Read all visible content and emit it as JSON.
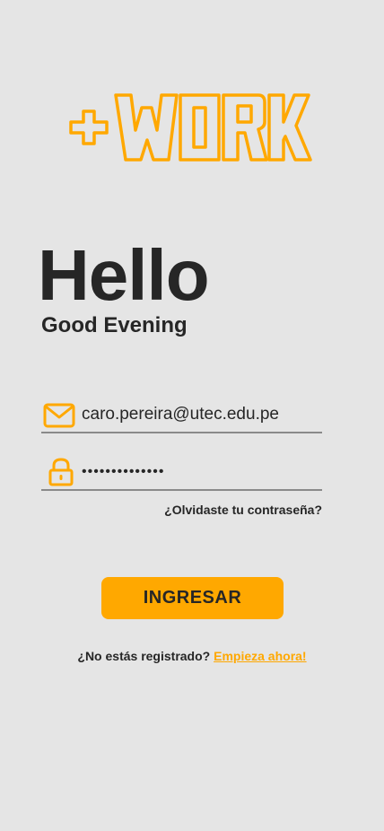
{
  "brand": {
    "logo_text": "+WORK",
    "accent_color": "#ffa800"
  },
  "greeting": {
    "title": "Hello",
    "subtitle": "Good Evening"
  },
  "form": {
    "email_icon": "mail-icon",
    "email_value": "caro.pereira@utec.edu.pe",
    "password_icon": "lock-icon",
    "password_value": "••••••••••••••",
    "forgot_link": "¿Olvidaste tu contraseña?",
    "submit_label": "INGRESAR"
  },
  "register": {
    "prompt": "¿No estás registrado?",
    "link": "Empieza ahora!"
  }
}
